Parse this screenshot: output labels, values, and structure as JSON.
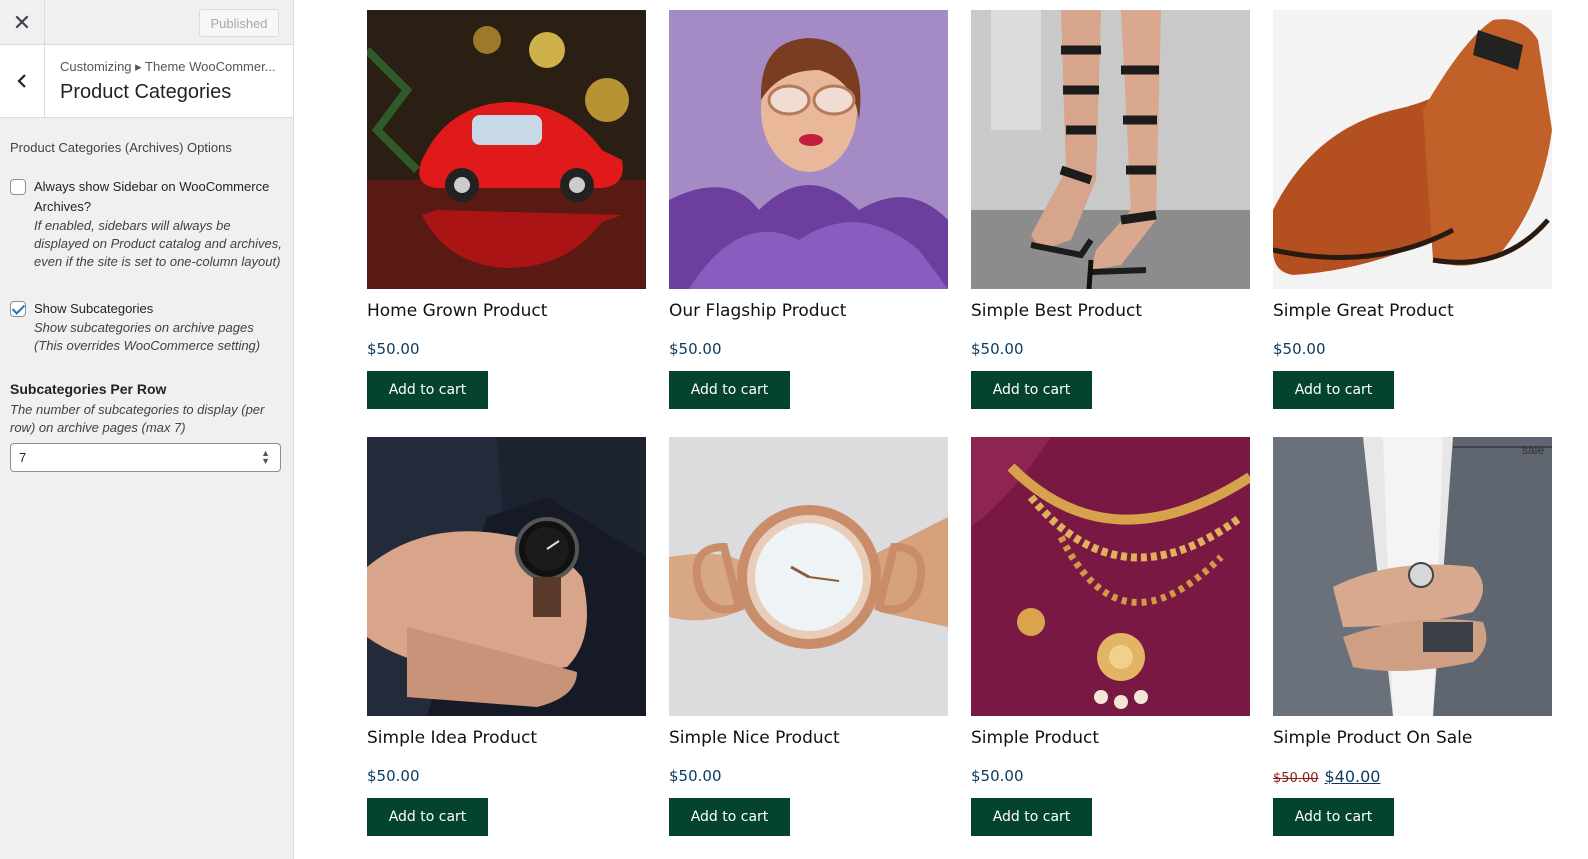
{
  "customizer": {
    "close_icon": "close-icon",
    "publish_label": "Published",
    "back_icon": "chevron-left-icon",
    "breadcrumb": "Customizing ▸ Theme WooCommer...",
    "section_title": "Product Categories",
    "options_heading": "Product Categories (Archives) Options",
    "sidebar_option": {
      "label": "Always show Sidebar on WooCommerce Archives?",
      "checked": false,
      "description": "If enabled, sidebars will always be displayed on Product catalog and archives, even if the site is set to one-column layout)"
    },
    "subcat_option": {
      "label": "Show Subcategories",
      "checked": true,
      "description": "Show subcategories on archive pages (This overrides WooCommerce setting)"
    },
    "per_row": {
      "title": "Subcategories Per Row",
      "description": "The number of subcategories to display (per row) on archive pages (max 7)",
      "value": "7"
    }
  },
  "products": [
    {
      "name": "Home Grown Product",
      "price": "$50.00",
      "button": "Add to cart",
      "image": "red-toy-car"
    },
    {
      "name": "Our Flagship Product",
      "price": "$50.00",
      "button": "Add to cart",
      "image": "woman-sunglasses"
    },
    {
      "name": "Simple Best Product",
      "price": "$50.00",
      "button": "Add to cart",
      "image": "strappy-heels"
    },
    {
      "name": "Simple Great Product",
      "price": "$50.00",
      "button": "Add to cart",
      "image": "brown-loafers"
    },
    {
      "name": "Simple Idea Product",
      "price": "$50.00",
      "button": "Add to cart",
      "image": "wrist-watch-suit"
    },
    {
      "name": "Simple Nice Product",
      "price": "$50.00",
      "button": "Add to cart",
      "image": "rose-gold-watch"
    },
    {
      "name": "Simple Product",
      "price": "$50.00",
      "button": "Add to cart",
      "image": "gold-necklace"
    },
    {
      "name": "Simple Product On Sale",
      "old_price": "$50.00",
      "price": "$40.00",
      "button": "Add to cart",
      "image": "grey-suit-watch",
      "badge": "sale"
    }
  ],
  "colors": {
    "button_bg": "#04442c",
    "price": "#0b3a5f",
    "sidebar_bg": "#f0f0f1"
  }
}
